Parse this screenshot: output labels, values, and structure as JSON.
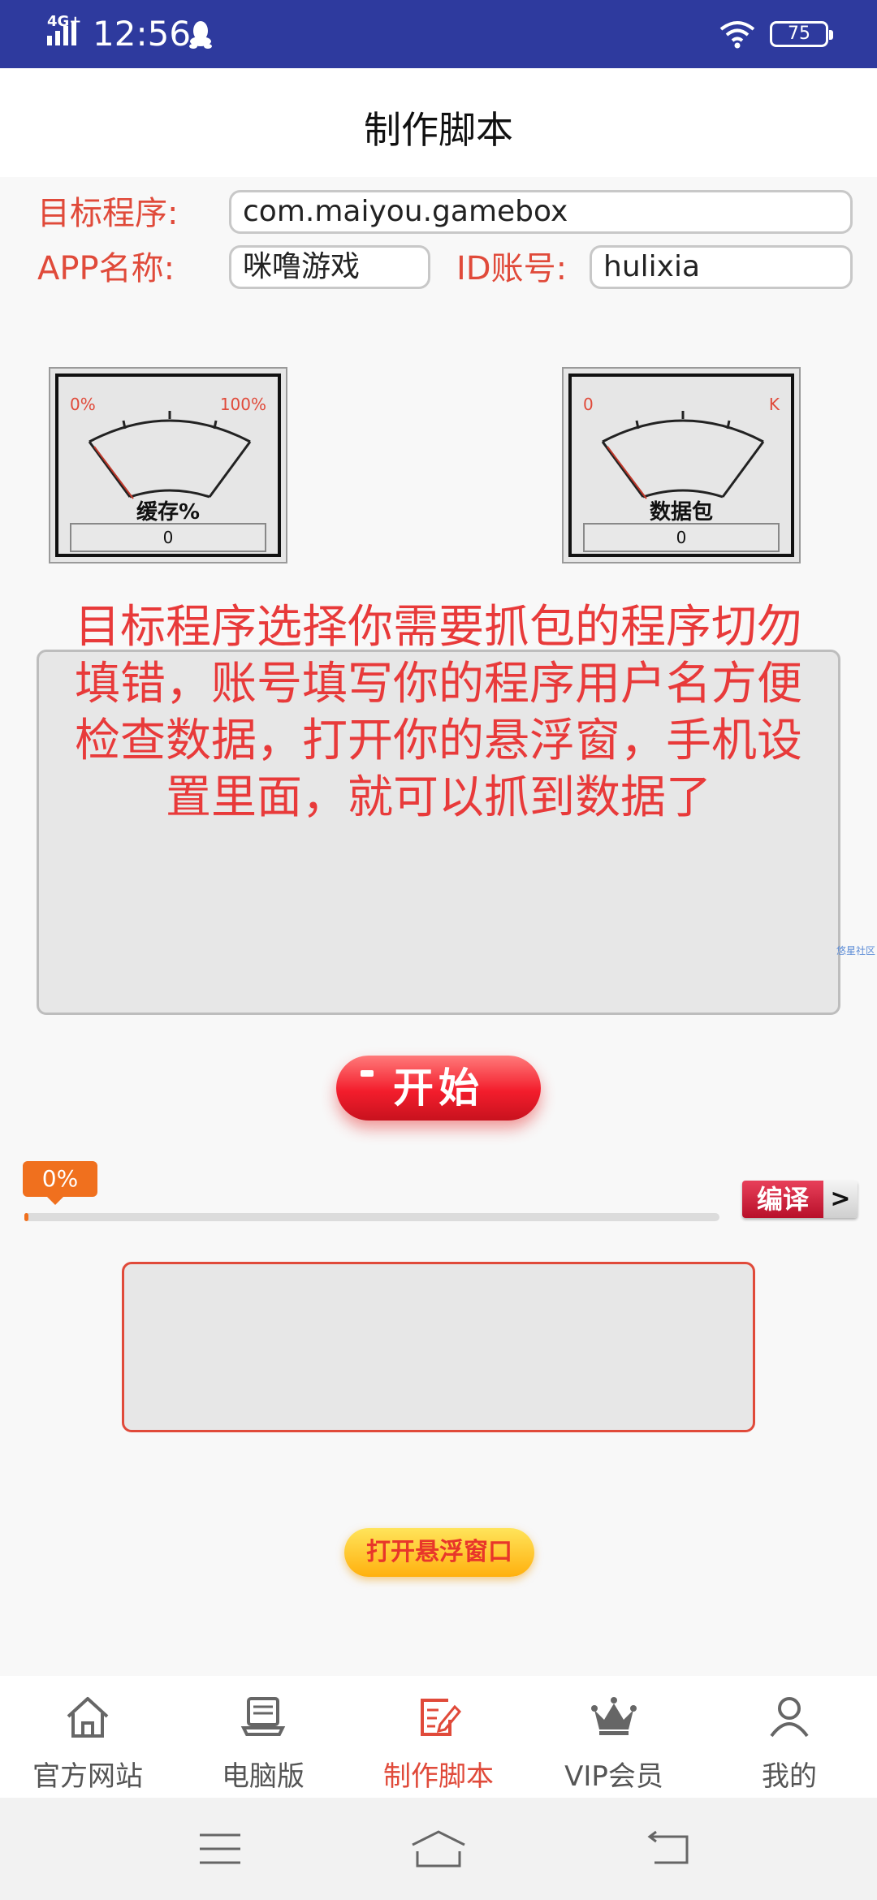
{
  "status_bar": {
    "network": "4G+",
    "time": "12:56",
    "battery": "75"
  },
  "header": {
    "title": "制作脚本"
  },
  "form": {
    "target_label": "目标程序:",
    "target_value": "com.maiyou.gamebox",
    "app_name_label": "APP名称:",
    "app_name_value": "咪噜游戏",
    "id_label": "ID账号:",
    "id_value": "hulixia"
  },
  "gauges": [
    {
      "min": "0%",
      "max": "100%",
      "label": "缓存%",
      "value": "0"
    },
    {
      "min": "0",
      "max": "K",
      "label": "数据包",
      "value": "0"
    }
  ],
  "instruction": {
    "lines": [
      "目标程序选择你需要抓包的程序切勿",
      "填错，账号填写你的程序用户名方便",
      "检查数据，打开你的悬浮窗，手机设",
      "置里面，就可以抓到数据了"
    ]
  },
  "side_link": "悠星社区",
  "start_button": "开始",
  "progress": {
    "label": "0%",
    "fraction": 0.0
  },
  "compile_button": "编译",
  "compile_arrow": ">",
  "float_button": "打开悬浮窗口",
  "nav": [
    {
      "label": "官方网站",
      "icon": "home-icon"
    },
    {
      "label": "电脑版",
      "icon": "laptop-icon"
    },
    {
      "label": "制作脚本",
      "icon": "edit-script-icon",
      "active": true
    },
    {
      "label": "VIP会员",
      "icon": "crown-icon"
    },
    {
      "label": "我的",
      "icon": "user-icon"
    }
  ],
  "colors": {
    "status_bar": "#2e3a9e",
    "accent_red": "#e04a3a",
    "progress_orange": "#f0701e"
  }
}
